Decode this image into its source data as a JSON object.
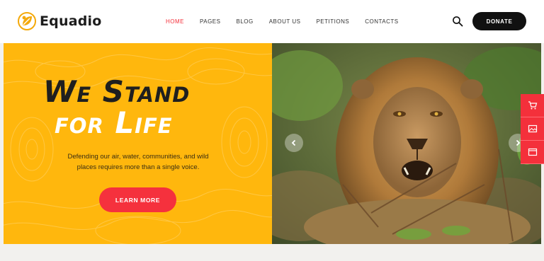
{
  "brand": {
    "name": "Equadio",
    "logo_icon": "leaf-sun-icon",
    "accent": "#f4a90a"
  },
  "nav": {
    "items": [
      {
        "label": "HOME",
        "active": true
      },
      {
        "label": "PAGES",
        "active": false
      },
      {
        "label": "BLOG",
        "active": false
      },
      {
        "label": "ABOUT US",
        "active": false
      },
      {
        "label": "PETITIONS",
        "active": false
      },
      {
        "label": "CONTACTS",
        "active": false
      }
    ],
    "active_color": "#f4303b"
  },
  "header": {
    "search_icon": "search-icon",
    "donate_label": "DONATE"
  },
  "hero": {
    "headline_line1": "We Stand",
    "headline_line2": "for Life",
    "subtext": "Defending our air, water, communities, and wild places requires more than a single voice.",
    "cta_label": "LEARN MORE",
    "bg_color": "#ffb70d",
    "cta_color": "#f5313d",
    "image": "lion-photo",
    "prev_icon": "chevron-left-icon",
    "next_icon": "chevron-right-icon"
  },
  "side_tools": [
    {
      "icon": "cart-icon"
    },
    {
      "icon": "image-icon"
    },
    {
      "icon": "browser-window-icon"
    }
  ]
}
